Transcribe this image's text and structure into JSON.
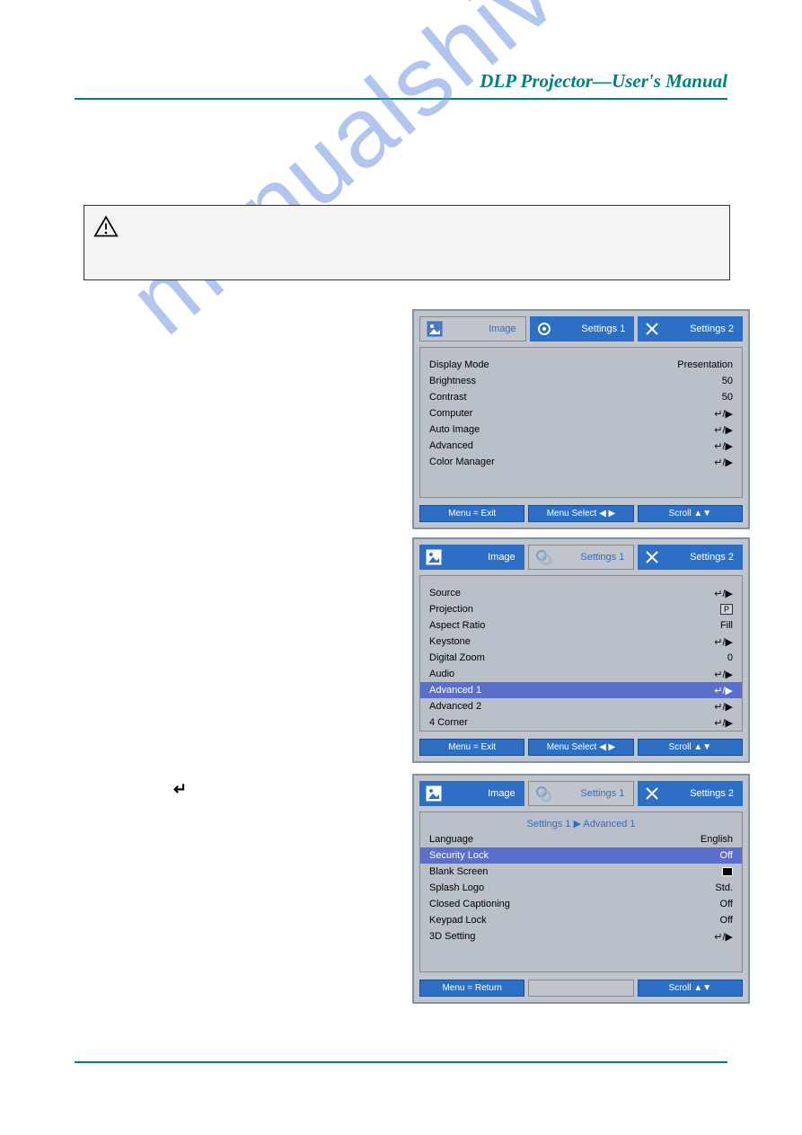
{
  "header": {
    "title": "DLP Projector—User's Manual"
  },
  "watermark": "manualshive.com",
  "tabs": {
    "image": "Image",
    "settings1": "Settings 1",
    "settings2": "Settings 2"
  },
  "footer": {
    "menu_exit": "Menu = Exit",
    "menu_return": "Menu = Return",
    "menu_select": "Menu Select ◀ ▶",
    "scroll": "Scroll ▲▼"
  },
  "osd1": {
    "rows": [
      {
        "label": "Display Mode",
        "value": "Presentation"
      },
      {
        "label": "Brightness",
        "value": "50"
      },
      {
        "label": "Contrast",
        "value": "50"
      },
      {
        "label": "Computer",
        "value": "↵/▶"
      },
      {
        "label": "Auto Image",
        "value": "↵/▶"
      },
      {
        "label": "Advanced",
        "value": "↵/▶"
      },
      {
        "label": "Color Manager",
        "value": "↵/▶"
      }
    ]
  },
  "osd2": {
    "rows": [
      {
        "label": "Source",
        "value": "↵/▶"
      },
      {
        "label": "Projection",
        "value": "P",
        "box": true
      },
      {
        "label": "Aspect Ratio",
        "value": "Fill"
      },
      {
        "label": "Keystone",
        "value": "↵/▶"
      },
      {
        "label": "Digital Zoom",
        "value": "0"
      },
      {
        "label": "Audio",
        "value": "↵/▶"
      },
      {
        "label": "Advanced 1",
        "value": "↵/▶",
        "hi": true
      },
      {
        "label": "Advanced 2",
        "value": "↵/▶"
      },
      {
        "label": "4 Corner",
        "value": "↵/▶"
      }
    ]
  },
  "osd3": {
    "breadcrumb": "Settings 1 ▶ Advanced 1",
    "rows": [
      {
        "label": "Language",
        "value": "English"
      },
      {
        "label": "Security Lock",
        "value": "Off",
        "hi": true
      },
      {
        "label": "Blank Screen",
        "value": "■",
        "blackbox": true
      },
      {
        "label": "Splash Logo",
        "value": "Std."
      },
      {
        "label": "Closed Captioning",
        "value": "Off"
      },
      {
        "label": "Keypad Lock",
        "value": "Off"
      },
      {
        "label": "3D Setting",
        "value": "↵/▶"
      }
    ]
  },
  "enter_arrow": "↵"
}
